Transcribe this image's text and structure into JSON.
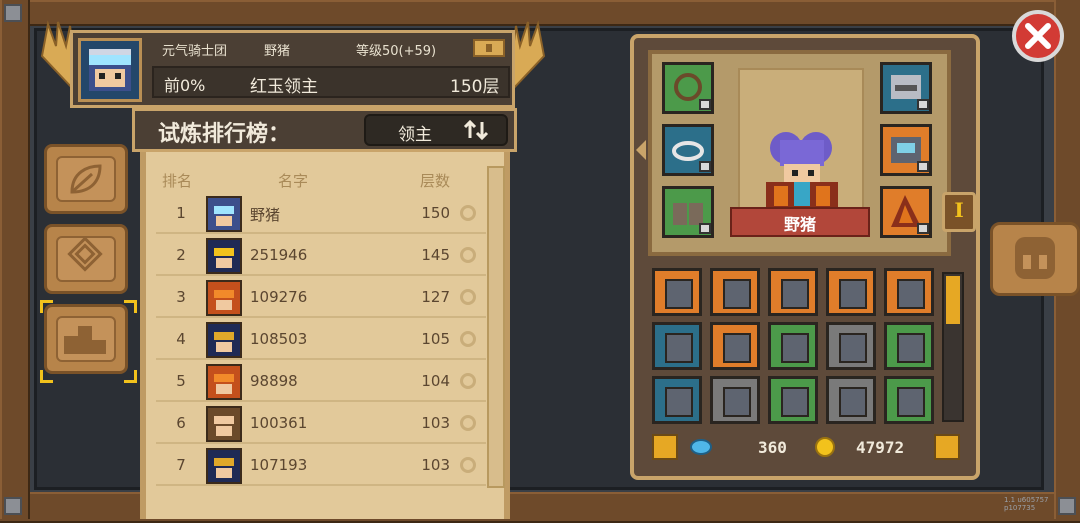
{
  "header": {
    "guild": "元气骑士团",
    "player_name": "野猪",
    "level": "等级50(+59)",
    "percent": "前0%",
    "boss": "红玉领主",
    "floor": "150层"
  },
  "leaderboard": {
    "title": "试炼排行榜：",
    "mode": "领主",
    "columns": [
      "排名",
      "名字",
      "层数"
    ],
    "rows": [
      {
        "rank": "1",
        "name": "野猪",
        "floors": "150"
      },
      {
        "rank": "2",
        "name": "251946",
        "floors": "145"
      },
      {
        "rank": "3",
        "name": "109276",
        "floors": "127"
      },
      {
        "rank": "4",
        "name": "108503",
        "floors": "105"
      },
      {
        "rank": "5",
        "name": "98898",
        "floors": "104"
      },
      {
        "rank": "6",
        "name": "100361",
        "floors": "103"
      },
      {
        "rank": "7",
        "name": "107193",
        "floors": "103"
      }
    ]
  },
  "character": {
    "name": "野猪",
    "level_badge": "I"
  },
  "currency": {
    "gems": "360",
    "gold": "47972"
  },
  "version": "1.1 u605757 p107735",
  "colors": {
    "panel_tan": "#e2c99a",
    "wood": "#6e4a2a",
    "gold_border": "#c9a46a",
    "close_red": "#d23b35",
    "banner_red": "#b2473a"
  },
  "icons": {
    "close": "close-x-icon",
    "sync": "sync-arrows-icon",
    "magnify": "magnify-icon",
    "leaf_tab": "leaf-icon",
    "diamond_tab": "diamond-icon",
    "podium_tab": "podium-icon",
    "helmet": "helmet-icon",
    "lock": "lock-icon",
    "chest": "chest-icon",
    "gem": "gem-icon",
    "coin": "coin-icon",
    "grid": "grid-icon"
  }
}
